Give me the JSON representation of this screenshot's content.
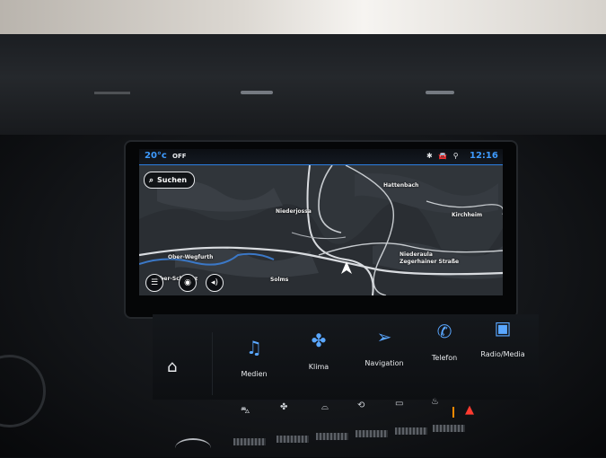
{
  "status": {
    "temperature": "20°c",
    "ac_state": "OFF",
    "icons": [
      "bluetooth-icon",
      "car-icon",
      "phone-signal-icon"
    ],
    "time": "12:16"
  },
  "search": {
    "label": "Suchen"
  },
  "map": {
    "places": [
      "Hattenbach",
      "Niederjossa",
      "Kirchheim",
      "Ober-Wegfurth",
      "Niederaula",
      "Zegerhainer Straße",
      "Solms",
      "Ober-Schwarz"
    ],
    "accent_color": "#3e9bff"
  },
  "dock": {
    "items": [
      {
        "id": "medien",
        "label": "Medien",
        "icon": "music-note-icon"
      },
      {
        "id": "klima",
        "label": "Klima",
        "icon": "fan-icon"
      },
      {
        "id": "navigation",
        "label": "Navigation",
        "icon": "navigation-arrow-icon"
      },
      {
        "id": "telefon",
        "label": "Telefon",
        "icon": "phone-icon"
      },
      {
        "id": "radio",
        "label": "Radio/Media",
        "icon": "radio-icon"
      }
    ]
  },
  "physical_buttons": [
    "car-icon",
    "fan-icon",
    "front-defrost-icon",
    "recirculation-icon",
    "rear-defrost-icon",
    "seat-heat-off-icon",
    "hazard-icon"
  ],
  "colors": {
    "screen_bg": "#2f3338",
    "accent": "#3e9bff",
    "hazard": "#ff3b30"
  }
}
